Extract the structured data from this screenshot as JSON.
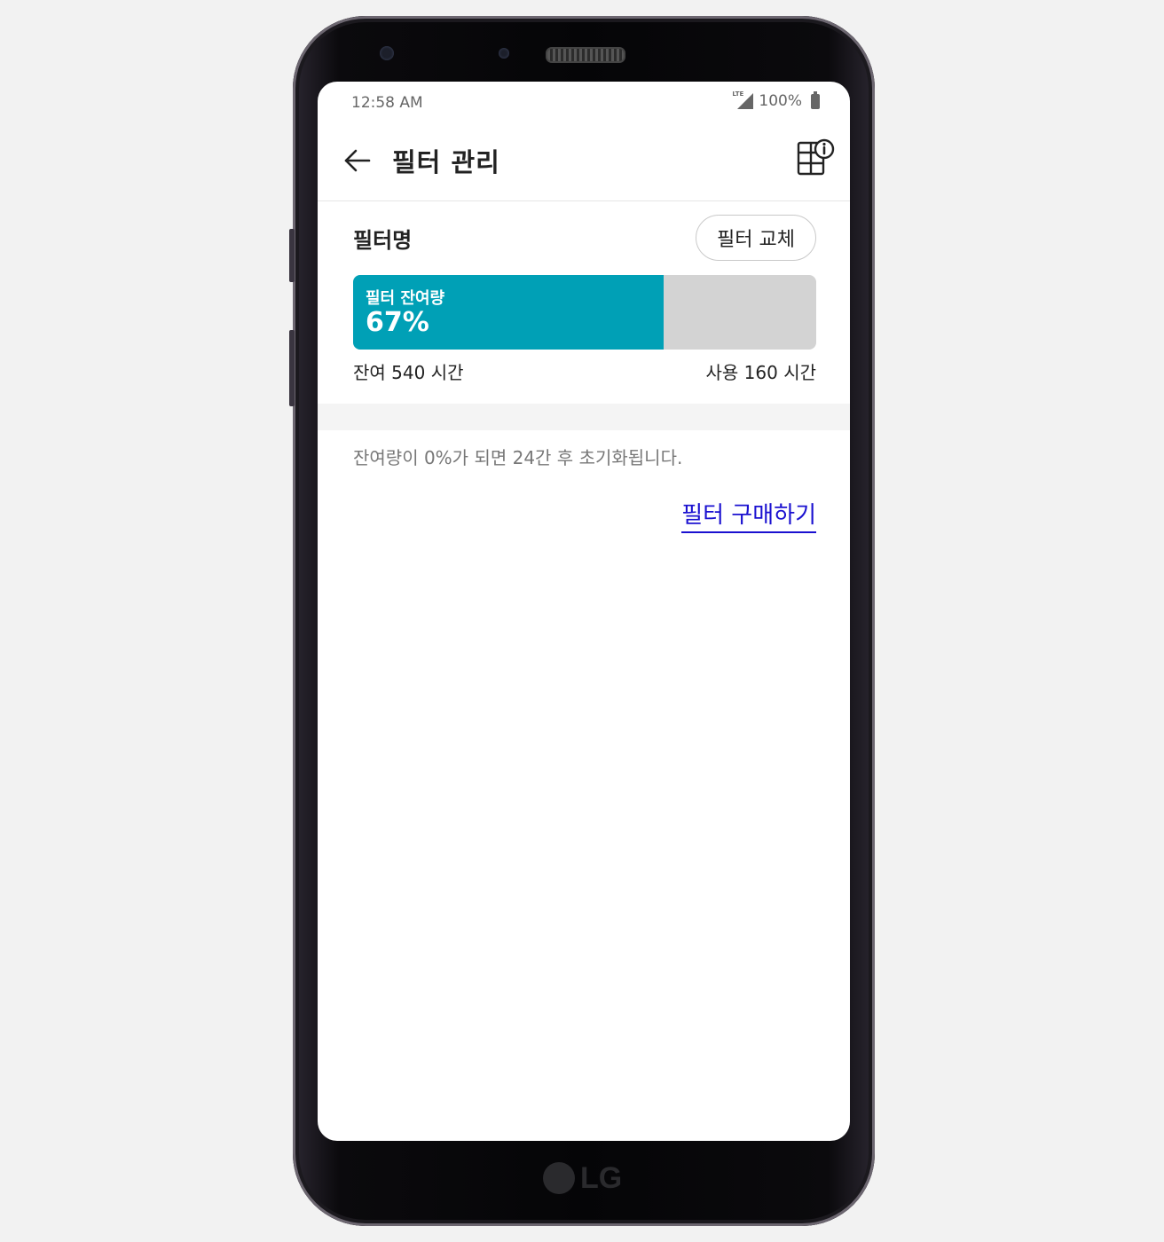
{
  "status_bar": {
    "time": "12:58 AM",
    "network_label": "LTE",
    "battery": "100%"
  },
  "app_bar": {
    "title": "필터 관리",
    "back_icon": "arrow-left-icon",
    "info_icon": "grid-info-icon"
  },
  "filter": {
    "name": "필터명",
    "replace_button": "필터 교체",
    "remaining_label": "필터 잔여량",
    "remaining_percent_text": "67%",
    "remaining_fraction": 0.67,
    "remaining_hours": "잔여 540 시간",
    "used_hours": "사용 160 시간"
  },
  "notice": "잔여량이 0%가 되면 24간 후 초기화됩니다.",
  "buy_link": "필터 구매하기",
  "colors": {
    "accent": "#00a0b6",
    "bar_track": "#d3d3d3",
    "link": "#1a10d0"
  },
  "device": {
    "brand": "LG"
  }
}
